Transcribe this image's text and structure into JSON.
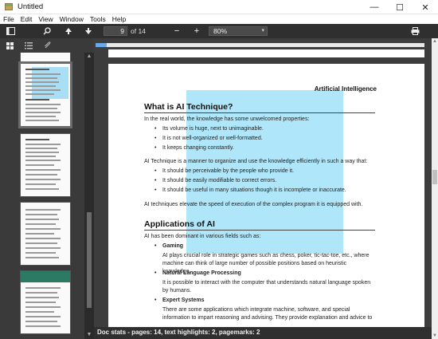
{
  "window": {
    "title": "Untitled",
    "minimize": "—",
    "maximize": "☐",
    "close": "✕"
  },
  "menu": [
    "File",
    "Edit",
    "View",
    "Window",
    "Tools",
    "Help"
  ],
  "toolbar": {
    "icons": [
      "sidebar-toggle-icon",
      "search-icon",
      "arrow-up-icon",
      "arrow-down-icon",
      "zoom-out-icon",
      "zoom-in-icon",
      "print-icon"
    ],
    "zoom_out": "−",
    "zoom_in": "+",
    "current_page": "9",
    "page_of": "of 14",
    "zoom": "80%",
    "zoom_caret": "▾"
  },
  "sidebar": {
    "tabs": [
      "thumbnails-icon",
      "outline-icon",
      "attachments-icon"
    ],
    "selected_thumb": 1
  },
  "document": {
    "progress_fraction": 0.035,
    "running_head": "Artificial Intelligence",
    "section1_title": "What is AI Technique?",
    "p1": "In the real world, the knowledge has some unwelcomed properties:",
    "bullets1": [
      "Its volume is huge, next to unimaginable.",
      "It is not well-organized or well-formatted.",
      "It keeps changing constantly."
    ],
    "p2": "AI Technique is a manner to organize and use the knowledge efficiently in such a way that:",
    "bullets2": [
      "It should be perceivable by the people who provide it.",
      "It should be easily modifiable to correct errors.",
      "It should be useful in many situations though it is incomplete or inaccurate."
    ],
    "p3": "AI techniques elevate the speed of execution of the complex program it is equipped with.",
    "section2_title": "Applications of AI",
    "p4": "AI has been dominant in various fields such as:",
    "apps": [
      {
        "title": "Gaming",
        "text": "AI plays crucial role in strategic games such as chess, poker, tic-tac-toe, etc., where machine can think of large number of possible positions based on heuristic knowledge."
      },
      {
        "title": "Natural Language Processing",
        "text": "It is possible to interact with the computer that understands natural language spoken by humans."
      },
      {
        "title": "Expert Systems",
        "text": "There are some applications which integrate machine, software, and special information to impart reasoning and advising. They provide explanation and advice to"
      }
    ]
  },
  "status": "Doc stats - pages: 14, text highlights: 2, pagemarks: 2",
  "colors": {
    "toolbar_bg": "#2f2f2f",
    "sidebar_bg": "#3a3a3a",
    "highlight": "#6ed2f5",
    "progress": "#6aa8e6"
  }
}
